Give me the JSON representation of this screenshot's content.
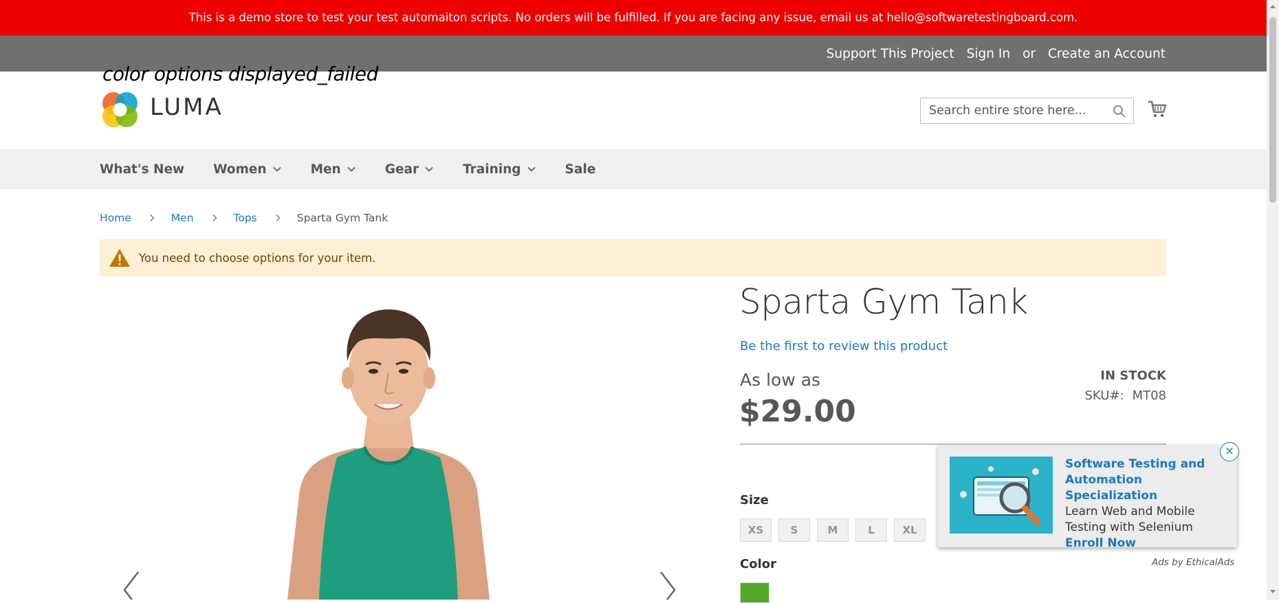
{
  "demo_banner": {
    "text": "This is a demo store to test your test automaiton scripts. No orders will be fulfilled. If you are facing any issue, email us at hello@softwaretestingboard.com."
  },
  "header": {
    "support_link": "Support This Project",
    "sign_in": "Sign In",
    "or": "or",
    "create_account": "Create an Account",
    "search_placeholder": "Search entire store here...",
    "logo_text": "LUMA"
  },
  "test_caption": "color options displayed_failed",
  "nav": {
    "items": [
      {
        "label": "What's New",
        "has_dropdown": false
      },
      {
        "label": "Women",
        "has_dropdown": true
      },
      {
        "label": "Men",
        "has_dropdown": true
      },
      {
        "label": "Gear",
        "has_dropdown": true
      },
      {
        "label": "Training",
        "has_dropdown": true
      },
      {
        "label": "Sale",
        "has_dropdown": false
      }
    ]
  },
  "breadcrumb": {
    "home": "Home",
    "men": "Men",
    "tops": "Tops",
    "current": "Sparta Gym Tank"
  },
  "message": {
    "text": "You need to choose options for your item."
  },
  "product": {
    "title": "Sparta Gym Tank",
    "review_link": "Be the first to review this product",
    "as_low_as": "As low as",
    "price": "$29.00",
    "stock": "IN STOCK",
    "sku_label": "SKU#:",
    "sku_value": "MT08",
    "size_label": "Size",
    "sizes": [
      "XS",
      "S",
      "M",
      "L",
      "XL"
    ],
    "color_label": "Color",
    "colors": [
      "#53a828"
    ]
  },
  "ad": {
    "title": "Software Testing and Automation Specialization",
    "body": "Learn Web and Mobile Testing with Selenium",
    "cta": "Enroll Now",
    "credit": "Ads by EthicalAds",
    "close": "×"
  },
  "colors": {
    "banner_red": "#ee0000",
    "header_grey": "#6e716e",
    "nav_bg": "#f0f0f0",
    "link_blue": "#1979c3",
    "message_bg": "#fdf0d5"
  }
}
